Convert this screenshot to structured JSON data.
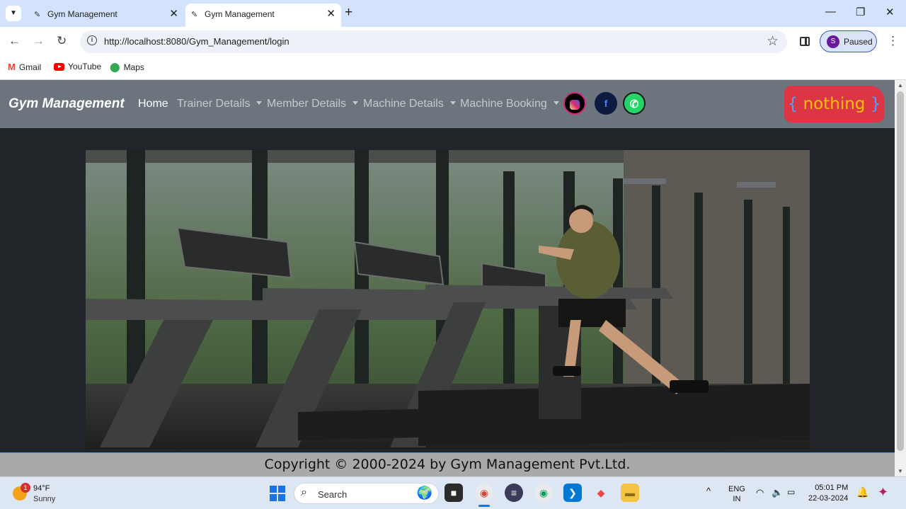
{
  "browser": {
    "tabs": [
      {
        "title": "Gym Management",
        "active": false
      },
      {
        "title": "Gym Management",
        "active": true
      }
    ],
    "url": "http://localhost:8080/Gym_Management/login",
    "profile_label": "Paused",
    "profile_initial": "S",
    "bookmarks": [
      {
        "label": "Gmail",
        "icon": "gmail-icon"
      },
      {
        "label": "YouTube",
        "icon": "youtube-icon"
      },
      {
        "label": "Maps",
        "icon": "maps-icon"
      }
    ]
  },
  "page": {
    "brand": "Gym Management",
    "nav": [
      {
        "label": "Home",
        "active": true,
        "dropdown": false
      },
      {
        "label": "Trainer Details",
        "active": false,
        "dropdown": true
      },
      {
        "label": "Member Details",
        "active": false,
        "dropdown": true
      },
      {
        "label": "Machine Details",
        "active": false,
        "dropdown": true
      },
      {
        "label": "Machine Booking",
        "active": false,
        "dropdown": true
      }
    ],
    "social_icons": [
      "instagram-icon",
      "facebook-icon",
      "whatsapp-icon"
    ],
    "badge": {
      "open": "{",
      "text": "nothing",
      "close": "}"
    },
    "footer": "Copyright © 2000-2024 by Gym Management Pvt.Ltd."
  },
  "taskbar": {
    "weather": {
      "temp": "94°F",
      "desc": "Sunny",
      "badge": "1"
    },
    "search_placeholder": "Search",
    "lang": {
      "line1": "ENG",
      "line2": "IN"
    },
    "time": "05:01 PM",
    "date": "22-03-2024"
  },
  "colors": {
    "navbar": "#6c757d",
    "body": "#212529",
    "badge_bg": "#dc3545",
    "badge_text": "#ffc107",
    "footer": "#a9a9a9"
  }
}
